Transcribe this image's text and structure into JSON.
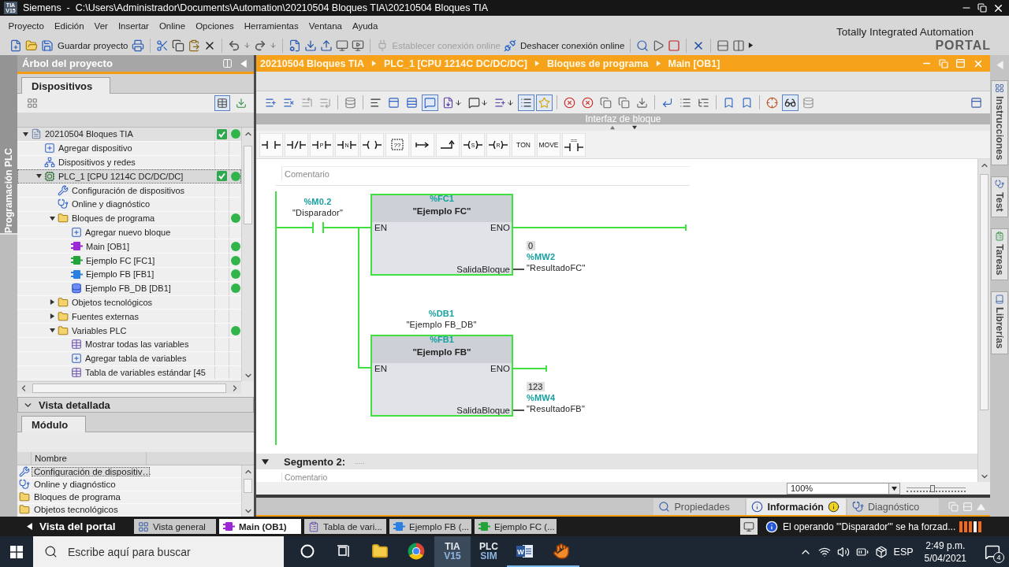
{
  "window": {
    "logo": [
      "TIA",
      "V15"
    ],
    "title": "Siemens  -  C:\\Users\\Administrador\\Documents\\Automation\\20210504 Bloques TIA\\20210504 Bloques TIA"
  },
  "menu": [
    "Proyecto",
    "Edición",
    "Ver",
    "Insertar",
    "Online",
    "Opciones",
    "Herramientas",
    "Ventana",
    "Ayuda"
  ],
  "toolbar": {
    "save": {
      "label": "Guardar proyecto",
      "disabled": false
    },
    "go_online": {
      "label": "Establecer conexión online",
      "disabled": true
    },
    "go_offline": {
      "label": "Deshacer conexión online",
      "disabled": false
    }
  },
  "brand": {
    "line1": "Totally Integrated Automation",
    "line2": "PORTAL"
  },
  "side_tab": "Programación PLC",
  "project_tree": {
    "title": "Árbol del proyecto",
    "tabs": [
      {
        "label": "Dispositivos",
        "selected": true
      }
    ],
    "toolbar": [
      {
        "kind": "overview",
        "on": false
      },
      {
        "kind": "table-view",
        "on": true
      },
      {
        "kind": "sync",
        "on": false
      }
    ],
    "items": [
      {
        "kind": "project",
        "label": "20210504 Bloques TIA",
        "expanded": true,
        "selected": false,
        "compiled": true,
        "in_sync": true,
        "children": [
          {
            "kind": "add-device",
            "label": "Agregar dispositivo",
            "selected": false
          },
          {
            "kind": "network",
            "label": "Dispositivos y redes",
            "selected": false
          },
          {
            "kind": "plc",
            "label": "PLC_1 [CPU 1214C DC/DC/DC]",
            "expanded": true,
            "selected": true,
            "compiled": true,
            "in_sync": true,
            "children": [
              {
                "kind": "config",
                "label": "Configuración de dispositivos",
                "selected": false
              },
              {
                "kind": "diag",
                "label": "Online y diagnóstico",
                "selected": false
              },
              {
                "kind": "folder",
                "label": "Bloques de programa",
                "expanded": true,
                "selected": false,
                "in_sync": true,
                "children": [
                  {
                    "kind": "add-block",
                    "label": "Agregar nuevo bloque",
                    "selected": false
                  },
                  {
                    "kind": "ob",
                    "label": "Main [OB1]",
                    "selected": false,
                    "in_sync": true
                  },
                  {
                    "kind": "fc",
                    "label": "Ejemplo FC [FC1]",
                    "selected": false,
                    "in_sync": true
                  },
                  {
                    "kind": "fb",
                    "label": "Ejemplo FB [FB1]",
                    "selected": false,
                    "in_sync": true
                  },
                  {
                    "kind": "db",
                    "label": "Ejemplo FB_DB [DB1]",
                    "selected": false,
                    "in_sync": true
                  }
                ]
              },
              {
                "kind": "folder",
                "label": "Objetos tecnológicos",
                "expanded": false,
                "selected": false
              },
              {
                "kind": "folder",
                "label": "Fuentes externas",
                "expanded": false,
                "selected": false
              },
              {
                "kind": "folder",
                "label": "Variables PLC",
                "expanded": true,
                "selected": false,
                "in_sync": true,
                "children": [
                  {
                    "kind": "show-tags",
                    "label": "Mostrar todas las variables",
                    "selected": false
                  },
                  {
                    "kind": "add-table",
                    "label": "Agregar tabla de variables",
                    "selected": false
                  },
                  {
                    "kind": "tag-table",
                    "label": "Tabla de variables estándar [45",
                    "selected": false
                  }
                ]
              }
            ]
          }
        ]
      }
    ]
  },
  "details": {
    "title": "Vista detallada",
    "expanded": true,
    "tabs": [
      {
        "label": "Módulo",
        "selected": true
      }
    ],
    "columns": [
      "Nombre"
    ],
    "rows": [
      {
        "kind": "config",
        "name": "Configuración de dispositiv…",
        "selected": true
      },
      {
        "kind": "diag",
        "name": "Online y diagnóstico",
        "selected": false
      },
      {
        "kind": "folder",
        "name": "Bloques de programa",
        "selected": false
      },
      {
        "kind": "folder",
        "name": "Objetos tecnológicos",
        "selected": false
      }
    ]
  },
  "editor": {
    "breadcrumb": [
      "20210504 Bloques TIA",
      "PLC_1 [CPU 1214C DC/DC/DC]",
      "Bloques de programa",
      "Main [OB1]"
    ],
    "toolbar": [
      [
        {
          "kind": "insert-network",
          "on": false
        },
        {
          "kind": "delete-network",
          "on": false
        },
        {
          "kind": "insert-row",
          "on": false
        },
        {
          "kind": "append-row",
          "on": false
        }
      ],
      [
        {
          "kind": "restore",
          "on": false
        }
      ],
      [
        {
          "kind": "absolute",
          "on": false
        },
        {
          "kind": "window",
          "on": false
        },
        {
          "kind": "rows",
          "on": false
        },
        {
          "kind": "comments",
          "on": true
        },
        {
          "kind": "load-list",
          "on": false
        },
        {
          "kind": "load-comments",
          "on": false
        },
        {
          "kind": "load-network",
          "on": false
        },
        {
          "kind": "list",
          "on": true
        },
        {
          "kind": "favorites",
          "on": true
        }
      ],
      [
        {
          "kind": "clear-a",
          "on": false
        },
        {
          "kind": "clear-b",
          "on": false
        },
        {
          "kind": "snapshot-a",
          "on": false
        },
        {
          "kind": "snapshot-b",
          "on": false
        },
        {
          "kind": "download",
          "on": false
        }
      ],
      [
        {
          "kind": "jump",
          "on": false
        },
        {
          "kind": "indent",
          "on": false
        },
        {
          "kind": "tree",
          "on": false
        }
      ],
      [
        {
          "kind": "prev",
          "on": false
        },
        {
          "kind": "next",
          "on": false
        }
      ],
      [
        {
          "kind": "inspect",
          "on": false
        },
        {
          "kind": "monitor",
          "on": true
        },
        {
          "kind": "lock",
          "on": false
        }
      ]
    ],
    "interface_label": "Interfaz de bloque",
    "favorites": [
      {
        "kind": "contact"
      },
      {
        "kind": "contact-nc"
      },
      {
        "kind": "contact",
        "label": "P"
      },
      {
        "kind": "contact",
        "label": "N"
      },
      {
        "kind": "coil"
      },
      {
        "kind": "empty-box",
        "label": "??"
      },
      {
        "kind": "branch-open"
      },
      {
        "kind": "branch-close"
      },
      {
        "kind": "coil",
        "label": "S"
      },
      {
        "kind": "coil",
        "label": "R"
      },
      {
        "kind": "box",
        "label": "TON"
      },
      {
        "kind": "box",
        "label": "MOVE"
      },
      {
        "kind": "compare",
        "label": "=="
      }
    ],
    "network_1": {
      "comment": {
        "placeholder": "Comentario"
      },
      "contact": {
        "address": "%M0.2",
        "tag": "\"Disparador\""
      },
      "blocks": [
        {
          "number": "%FC1",
          "name": "\"Ejemplo FC\"",
          "en": "EN",
          "eno": "ENO",
          "eno_connected": true,
          "output_pin": "SalidaBloque",
          "value": "0",
          "address": "%MW2",
          "tag": "\"ResultadoFC\""
        },
        {
          "instance": {
            "address": "%DB1",
            "tag": "\"Ejemplo FB_DB\""
          },
          "number": "%FB1",
          "name": "\"Ejemplo FB\"",
          "en": "EN",
          "eno": "ENO",
          "eno_connected": false,
          "output_pin": "SalidaBloque",
          "value": "123",
          "address": "%MW4",
          "tag": "\"ResultadoFB\""
        }
      ]
    },
    "network_2": {
      "title": "Segmento 2:",
      "title_placeholder": ".....",
      "expanded": true,
      "comment": {
        "placeholder": "Comentario"
      }
    },
    "zoom": {
      "value": "100%",
      "level": 0.44
    }
  },
  "inspector_tabs": [
    {
      "label": "Propiedades",
      "selected": false,
      "badge": false
    },
    {
      "label": "Información",
      "selected": true,
      "badge": true
    },
    {
      "label": "Diagnóstico",
      "selected": false,
      "badge": false
    }
  ],
  "task_cards": [
    "Instrucciones",
    "Test",
    "Tareas",
    "Librerías"
  ],
  "portal_bar": {
    "portal_label": "Vista del portal",
    "tasks": [
      {
        "kind": "overview",
        "label": "Vista general",
        "selected": false
      },
      {
        "kind": "ob",
        "label": "Main (OB1)",
        "selected": true
      },
      {
        "kind": "tag-table",
        "label": "Tabla de vari...",
        "selected": false
      },
      {
        "kind": "fb",
        "label": "Ejemplo FB (...",
        "selected": false
      },
      {
        "kind": "fc",
        "label": "Ejemplo FC (...",
        "selected": false
      }
    ],
    "message": "El operando '\"Disparador\"' se ha forzad..."
  },
  "taskbar": {
    "search": {
      "placeholder": "Escribe aquí para buscar"
    },
    "apps": [
      {
        "kind": "cortana",
        "selected": false,
        "running": false
      },
      {
        "kind": "task-view",
        "selected": false,
        "running": false
      },
      {
        "kind": "explorer",
        "selected": false,
        "running": false
      },
      {
        "kind": "browser",
        "selected": false,
        "running": false
      },
      {
        "kind": "tile",
        "label": [
          "TIA",
          "V15"
        ],
        "selected": true,
        "running": false
      },
      {
        "kind": "tile",
        "label": [
          "PLC",
          "SIM"
        ],
        "selected": false,
        "running": false
      },
      {
        "kind": "word",
        "label": "W",
        "selected": false,
        "running": true
      },
      {
        "kind": "hand",
        "selected": false,
        "running": true
      }
    ],
    "tray": {
      "language": "ESP",
      "time": "2:49 p.m.",
      "date": "5/04/2021",
      "notifications": "4"
    }
  }
}
